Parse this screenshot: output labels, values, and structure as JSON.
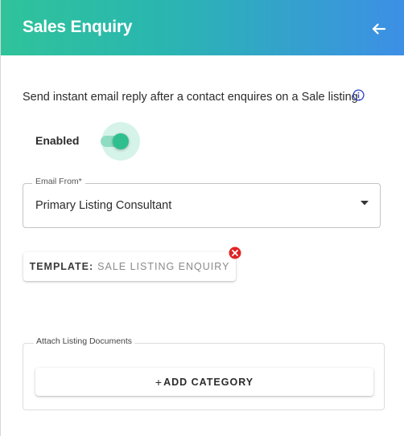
{
  "header": {
    "title": "Sales Enquiry",
    "back_icon": "arrow-left-icon",
    "gradient_start": "#2fc39a",
    "gradient_end": "#3d8fe6"
  },
  "description": {
    "text": "Send instant email reply after a contact enquires on a Sale listing.",
    "info_icon": "info-icon"
  },
  "enabled_toggle": {
    "label": "Enabled",
    "on": true,
    "accent": "#2fbf8f"
  },
  "email_from": {
    "label": "Email From*",
    "value": "Primary Listing Consultant",
    "icon": "caret-down-icon"
  },
  "template": {
    "prefix": "TEMPLATE:",
    "name": "SALE LISTING ENQUIRY",
    "remove_icon": "remove-icon",
    "remove_color": "#e02424"
  },
  "attach": {
    "label": "Attach Listing Documents",
    "add_icon": "plus-icon",
    "add_label": "ADD CATEGORY"
  }
}
